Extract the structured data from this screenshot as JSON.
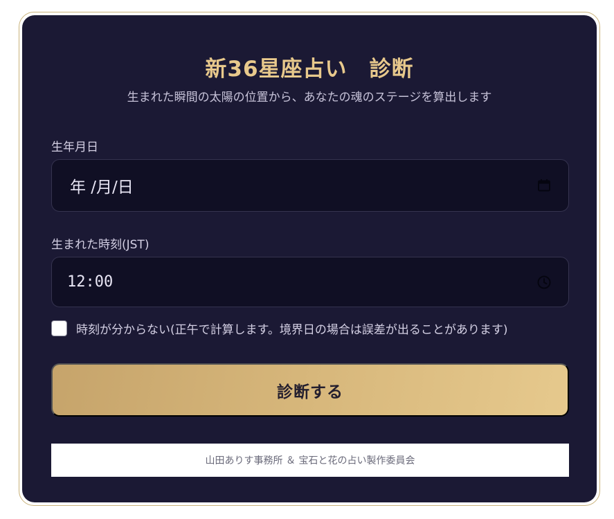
{
  "header": {
    "title": "新36星座占い　診断",
    "subtitle": "生まれた瞬間の太陽の位置から、あなたの魂のステージを算出します"
  },
  "form": {
    "birthdate": {
      "label": "生年月日",
      "value": "年 /月/日",
      "icon": "calendar-icon"
    },
    "birthtime": {
      "label": "生まれた時刻(JST)",
      "value": "12:00",
      "icon": "clock-icon"
    },
    "unknown_time": {
      "checked": false,
      "label": "時刻が分からない(正午で計算します。境界日の場合は誤差が出ることがあります)"
    },
    "submit_label": "診断する"
  },
  "footer": {
    "credit": "山田ありす事務所 ＆ 宝石と花の占い製作委員会"
  },
  "colors": {
    "background": "#1b1934",
    "accent": "#e8c98c",
    "button_gradient_start": "#c6a46b",
    "button_gradient_end": "#e6c98d"
  }
}
